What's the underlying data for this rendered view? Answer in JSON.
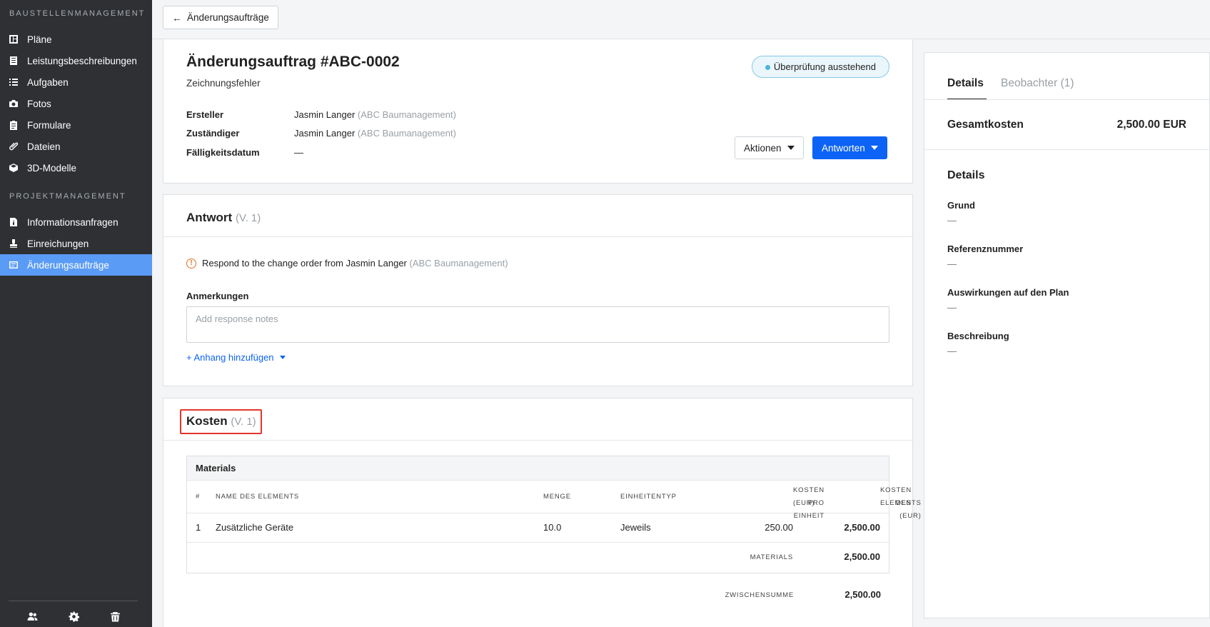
{
  "sidebar": {
    "section1": "BAUSTELLENMANAGEMENT",
    "section2": "PROJEKTMANAGEMENT",
    "items1": [
      {
        "label": "Pläne",
        "icon": "plans-icon"
      },
      {
        "label": "Leistungsbeschreibungen",
        "icon": "spec-book-icon"
      },
      {
        "label": "Aufgaben",
        "icon": "list-icon"
      },
      {
        "label": "Fotos",
        "icon": "camera-icon"
      },
      {
        "label": "Formulare",
        "icon": "clipboard-icon"
      },
      {
        "label": "Dateien",
        "icon": "paperclip-icon"
      },
      {
        "label": "3D-Modelle",
        "icon": "cube-icon"
      }
    ],
    "items2": [
      {
        "label": "Informationsanfragen",
        "icon": "info-file-icon"
      },
      {
        "label": "Einreichungen",
        "icon": "stamp-icon"
      },
      {
        "label": "Änderungsaufträge",
        "icon": "change-order-icon",
        "active": true
      }
    ]
  },
  "topbar": {
    "back_label": "Änderungsaufträge"
  },
  "header": {
    "title": "Änderungsauftrag #ABC-0002",
    "subtitle": "Zeichnungsfehler",
    "status": "Überprüfung ausstehend",
    "creator_label": "Ersteller",
    "creator_name": "Jasmin Langer",
    "creator_org": "(ABC Baumanagement)",
    "assignee_label": "Zuständiger",
    "assignee_name": "Jasmin Langer",
    "assignee_org": "(ABC Baumanagement)",
    "due_label": "Fälligkeitsdatum",
    "due_value": "—",
    "actions_label": "Aktionen",
    "reply_label": "Antworten"
  },
  "response": {
    "title": "Antwort",
    "version": "(V. 1)",
    "notice_text": "Respond to the change order from Jasmin Langer",
    "notice_org": "(ABC Baumanagement)",
    "notes_label": "Anmerkungen",
    "notes_placeholder": "Add response notes",
    "attach_label": "+ Anhang hinzufügen"
  },
  "costs": {
    "title": "Kosten",
    "version": "(V. 1)",
    "table_title": "Materials",
    "columns": {
      "num": "#",
      "name": "NAME DES ELEMENTS",
      "qty": "MENGE",
      "unit": "EINHEITENTYP",
      "unit_cost_1": "KOSTEN PRO EINHEIT",
      "unit_cost_2": "(EUR)",
      "item_cost_1": "KOSTEN DES",
      "item_cost_2": "ELEMENTS (EUR)"
    },
    "rows": [
      {
        "num": "1",
        "name": "Zusätzliche Geräte",
        "qty": "10.0",
        "unit": "Jeweils",
        "unit_cost": "250.00",
        "item_cost": "2,500.00"
      }
    ],
    "materials_label": "MATERIALS",
    "materials_total": "2,500.00",
    "subtotal_label": "ZWISCHENSUMME",
    "subtotal_value": "2,500.00"
  },
  "right_panel": {
    "tab_details": "Details",
    "tab_watchers": "Beobachter",
    "tab_watchers_count": "(1)",
    "total_label": "Gesamtkosten",
    "total_value": "2,500.00 EUR",
    "details_heading": "Details",
    "fields": [
      {
        "label": "Grund",
        "value": "—"
      },
      {
        "label": "Referenznummer",
        "value": "—"
      },
      {
        "label": "Auswirkungen auf den Plan",
        "value": "—"
      },
      {
        "label": "Beschreibung",
        "value": "—"
      }
    ]
  },
  "colors": {
    "accent": "#0d63f5",
    "active_nav": "#5a9bf5",
    "sidebar": "#2e3033",
    "highlight": "#e3352b"
  }
}
